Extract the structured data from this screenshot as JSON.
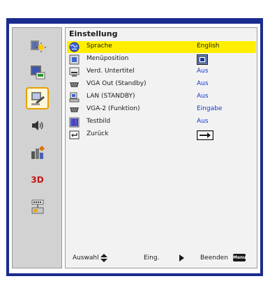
{
  "colors": {
    "frame": "#1b2c8f",
    "highlight": "#ffee00",
    "value_text": "#1638c8",
    "active_tab_border": "#e8a000"
  },
  "sidebar": {
    "tabs": [
      {
        "name": "image-settings-icon",
        "active": false
      },
      {
        "name": "display-settings-icon",
        "active": false
      },
      {
        "name": "settings-icon",
        "active": true
      },
      {
        "name": "volume-icon",
        "active": false
      },
      {
        "name": "options-icon",
        "active": false
      },
      {
        "name": "3d-icon",
        "label": "3D",
        "active": false
      },
      {
        "name": "lan-icon",
        "active": false
      }
    ]
  },
  "main": {
    "title": "Einstellung",
    "items": [
      {
        "label": "Sprache",
        "value": "English",
        "icon": "globe-icon",
        "selected": true
      },
      {
        "label": "Menüposition",
        "value": "",
        "icon": "menu-position-icon"
      },
      {
        "label": "Verd. Untertitel",
        "value": "Aus",
        "icon": "closed-caption-icon"
      },
      {
        "label": "VGA Out (Standby)",
        "value": "Aus",
        "icon": "vga-out-icon"
      },
      {
        "label": "LAN (STANDBY)",
        "value": "Aus",
        "icon": "lan-standby-icon"
      },
      {
        "label": "VGA-2 (Funktion)",
        "value": "Eingabe",
        "icon": "vga2-icon"
      },
      {
        "label": "Testbild",
        "value": "Aus",
        "icon": "test-pattern-icon"
      },
      {
        "label": "Zurück",
        "value": "",
        "icon": "back-icon"
      }
    ]
  },
  "footer": {
    "select_label": "Auswahl",
    "enter_label": "Eing.",
    "exit_label": "Beenden",
    "menu_key": "Menu"
  }
}
